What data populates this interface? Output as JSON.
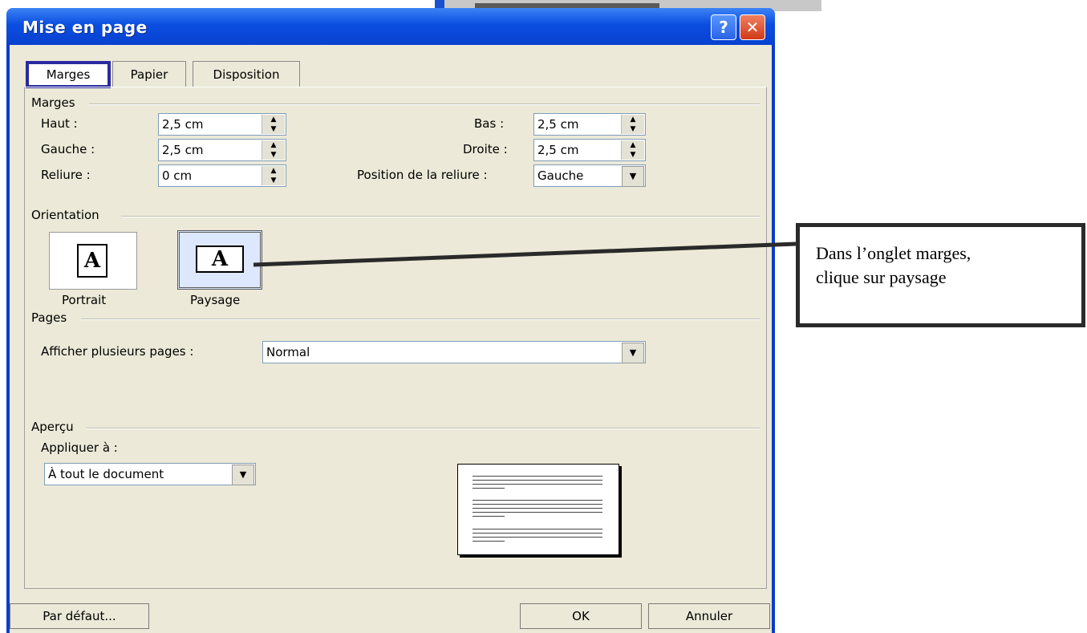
{
  "window": {
    "title": "Mise en page",
    "help_glyph": "?",
    "close_glyph": "✕"
  },
  "tabs": [
    {
      "label": "Marges",
      "active": true
    },
    {
      "label": "Papier",
      "active": false
    },
    {
      "label": "Disposition",
      "active": false
    }
  ],
  "marges": {
    "group_label": "Marges",
    "haut": {
      "label": "Haut :",
      "value": "2,5 cm"
    },
    "gauche": {
      "label": "Gauche :",
      "value": "2,5 cm"
    },
    "reliure": {
      "label": "Reliure :",
      "value": "0 cm"
    },
    "bas": {
      "label": "Bas :",
      "value": "2,5 cm"
    },
    "droite": {
      "label": "Droite :",
      "value": "2,5 cm"
    },
    "position_reliure": {
      "label": "Position de la reliure :",
      "value": "Gauche"
    }
  },
  "orientation": {
    "group_label": "Orientation",
    "portrait": {
      "label": "Portrait",
      "glyph": "A"
    },
    "paysage": {
      "label": "Paysage",
      "glyph": "A"
    }
  },
  "pages": {
    "group_label": "Pages",
    "plusieurs": {
      "label": "Afficher plusieurs pages :",
      "value": "Normal"
    }
  },
  "apercu": {
    "group_label": "Aperçu",
    "appliquer": {
      "label": "Appliquer à :",
      "value": "À tout le document"
    }
  },
  "buttons": {
    "default": "Par défaut...",
    "ok": "OK",
    "cancel": "Annuler"
  },
  "callout": {
    "line1": "Dans l’onglet marges,",
    "line2": "clique sur paysage"
  },
  "colors": {
    "titlebar": "#0a4ee0",
    "dialog_bg": "#ece9d8",
    "tab_highlight": "#2a2a9e"
  },
  "icons": {
    "spin_up": "▲",
    "spin_down": "▼",
    "combo_arrow": "▼"
  }
}
